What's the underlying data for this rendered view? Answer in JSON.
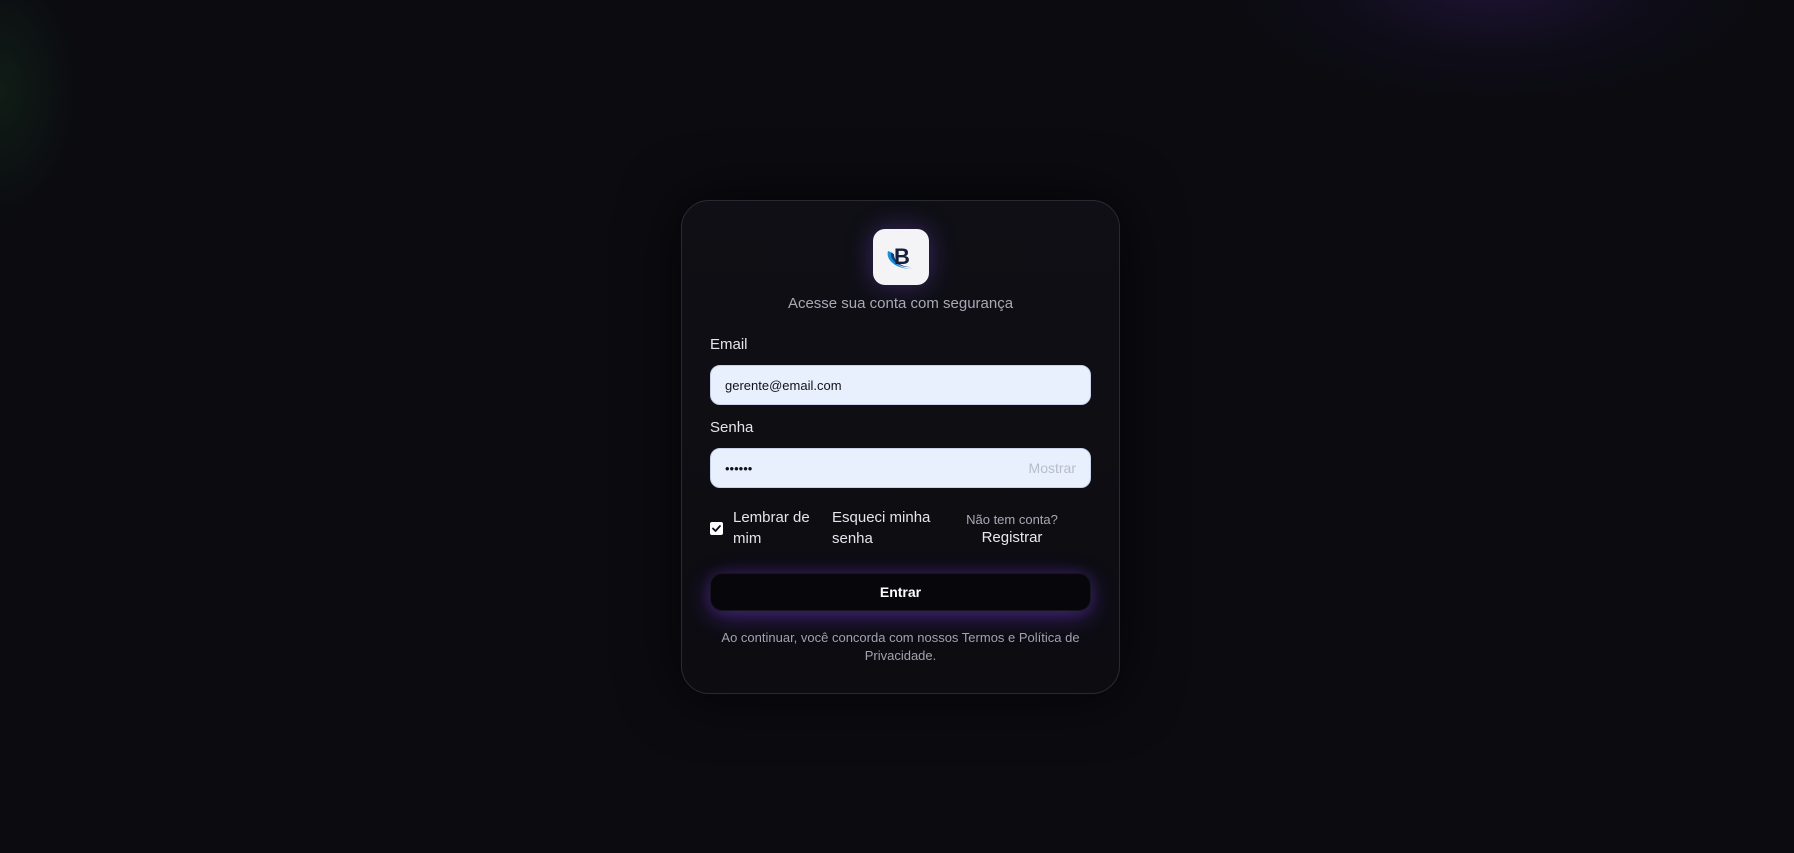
{
  "login": {
    "subtitle": "Acesse sua conta com segurança",
    "email_label": "Email",
    "email_value": "gerente@email.com",
    "password_label": "Senha",
    "password_value": "••••••",
    "show_password_label": "Mostrar",
    "remember_label": "Lembrar de mim",
    "remember_checked": true,
    "forgot_label": "Esqueci minha senha",
    "no_account_text": "Não tem conta?",
    "register_label": "Registrar",
    "submit_label": "Entrar",
    "terms_text": "Ao continuar, você concorda com nossos Termos e Política de Privacidade."
  },
  "logo": {
    "letter": "B",
    "icon": "brand-logo-icon",
    "colors": {
      "letter": "#14203a",
      "swoosh_outer": "#1e8fd6",
      "swoosh_inner": "#0d3f7a",
      "tile_background": "#f4f4f7"
    }
  },
  "theme": {
    "background": "#0b0b10",
    "card_border": "#2a2a34",
    "input_background": "#e8f0fe",
    "button_glow": "#7a3cdc"
  }
}
